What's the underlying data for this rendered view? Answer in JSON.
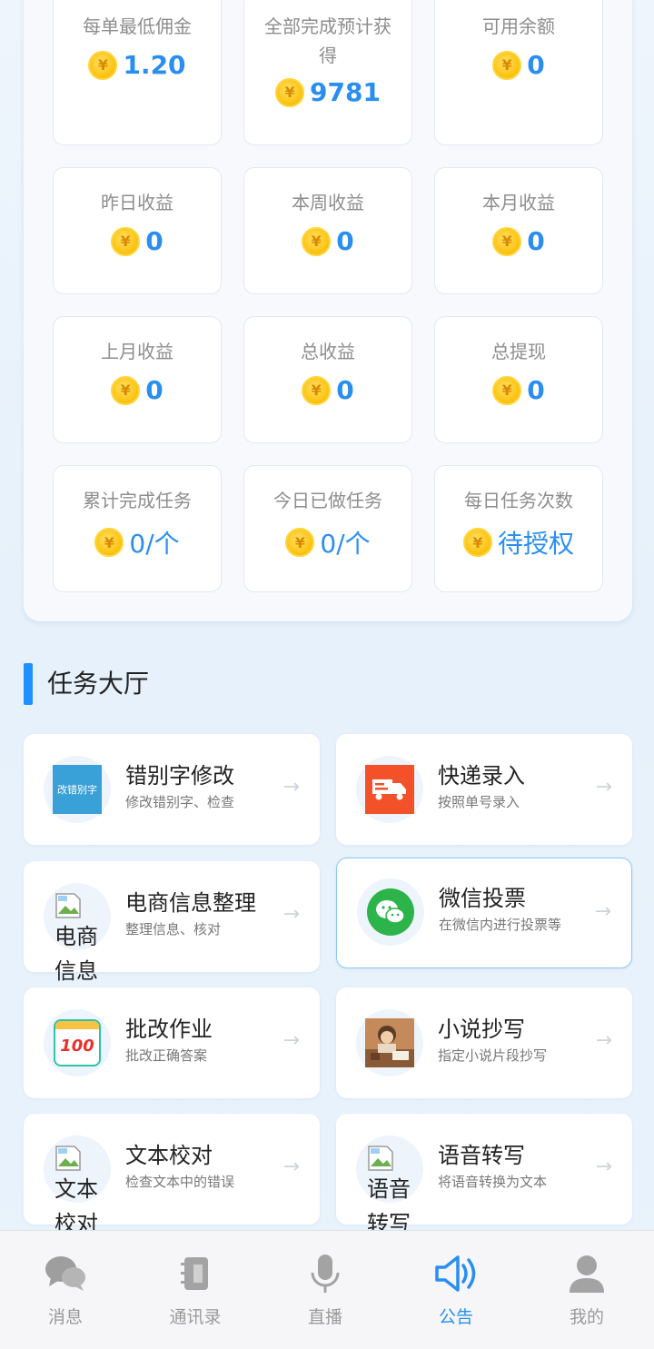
{
  "stats": [
    {
      "label": "每单最低佣金",
      "value": "1.20"
    },
    {
      "label": "全部完成预计获得",
      "value": "9781"
    },
    {
      "label": "可用余额",
      "value": "0"
    },
    {
      "label": "昨日收益",
      "value": "0"
    },
    {
      "label": "本周收益",
      "value": "0"
    },
    {
      "label": "本月收益",
      "value": "0"
    },
    {
      "label": "上月收益",
      "value": "0"
    },
    {
      "label": "总收益",
      "value": "0"
    },
    {
      "label": "总提现",
      "value": "0"
    },
    {
      "label": "累计完成任务",
      "value": "0/个"
    },
    {
      "label": "今日已做任务",
      "value": "0/个"
    },
    {
      "label": "每日任务次数",
      "value": "待授权"
    }
  ],
  "coin_symbol": "¥",
  "section": {
    "title": "任务大厅"
  },
  "tasks": [
    {
      "title": "错别字修改",
      "subtitle": "修改错别字、检查",
      "icon": "typo-correction-icon",
      "icon_text": "改错别字",
      "arrow": "→"
    },
    {
      "title": "快递录入",
      "subtitle": "按照单号录入",
      "icon": "delivery-truck-icon",
      "arrow": "→"
    },
    {
      "title": "电商信息整理",
      "subtitle": "整理信息、核对",
      "icon": "broken-image-icon",
      "alt": "电商信息",
      "arrow": "→"
    },
    {
      "title": "微信投票",
      "subtitle": "在微信内进行投票等",
      "icon": "wechat-icon",
      "arrow": "→"
    },
    {
      "title": "批改作业",
      "subtitle": "批改正确答案",
      "icon": "score-100-icon",
      "icon_text": "100",
      "arrow": "→"
    },
    {
      "title": "小说抄写",
      "subtitle": "指定小说片段抄写",
      "icon": "novel-illustration-icon",
      "arrow": "→"
    },
    {
      "title": "文本校对",
      "subtitle": "检查文本中的错误",
      "icon": "broken-image-icon",
      "alt": "文本校对",
      "arrow": "→"
    },
    {
      "title": "语音转写",
      "subtitle": "将语音转换为文本",
      "icon": "broken-image-icon",
      "alt": "语音转写",
      "arrow": "→"
    }
  ],
  "nav": [
    {
      "label": "消息",
      "icon": "chat-bubbles-icon"
    },
    {
      "label": "通讯录",
      "icon": "contacts-book-icon"
    },
    {
      "label": "直播",
      "icon": "microphone-icon"
    },
    {
      "label": "公告",
      "icon": "speaker-icon",
      "active": true
    },
    {
      "label": "我的",
      "icon": "user-icon"
    }
  ],
  "colors": {
    "accent": "#2a8ef0",
    "section_bar": "#1e90ff",
    "coin": "#fcc516"
  }
}
